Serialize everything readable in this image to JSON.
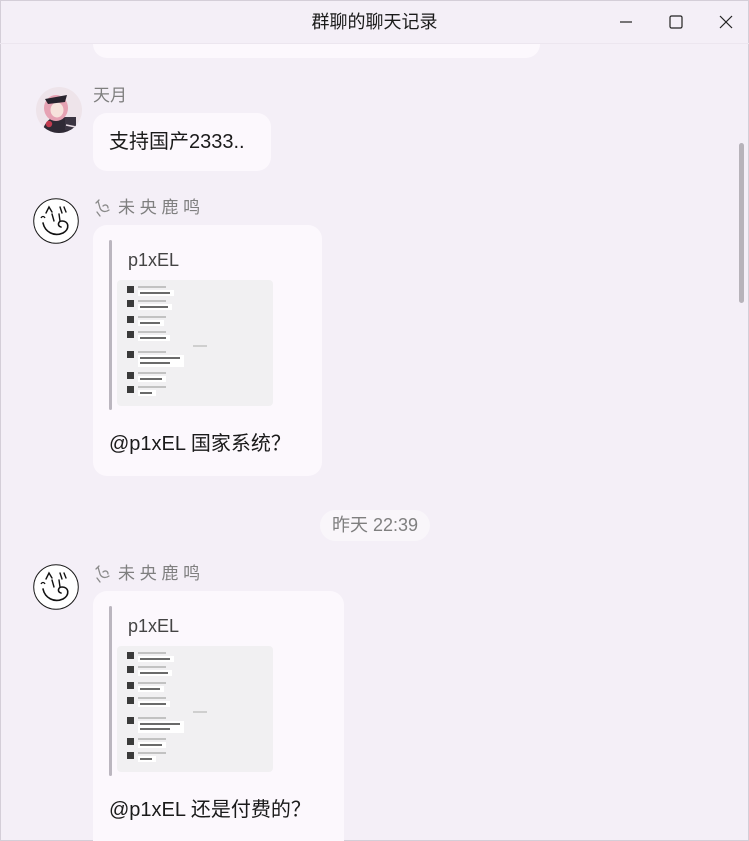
{
  "window": {
    "title": "群聊的聊天记录"
  },
  "title_bar_controls": {
    "minimize_icon": "minimize-icon",
    "maximize_icon": "maximize-icon",
    "close_icon": "close-icon"
  },
  "history": {
    "items": [
      {
        "type": "message",
        "sender": "天月",
        "avatar_icon": "anime-character-avatar-icon",
        "text": "支持国产2333.."
      },
      {
        "type": "message",
        "sender": "未 央 鹿 鸣",
        "sender_prefix_icon": "doodle-glyph-icon",
        "avatar_icon": "doodle-sketch-avatar-icon",
        "quote": {
          "author": "p1xEL"
        },
        "text": "@p1xEL 国家系统？"
      },
      {
        "type": "time_divider",
        "label": "昨天 22:39"
      },
      {
        "type": "message",
        "sender": "未 央 鹿 鸣",
        "sender_prefix_icon": "doodle-glyph-icon",
        "avatar_icon": "doodle-sketch-avatar-icon",
        "quote": {
          "author": "p1xEL"
        },
        "text": "@p1xEL 还是付费的？"
      }
    ]
  },
  "colors": {
    "window_bg": "#f4eff7",
    "bubble_bg": "#fcf8fd",
    "text": "#1a1a1a",
    "secondary_text": "#7f7f7f",
    "quote_bar": "#bbb6bf"
  }
}
